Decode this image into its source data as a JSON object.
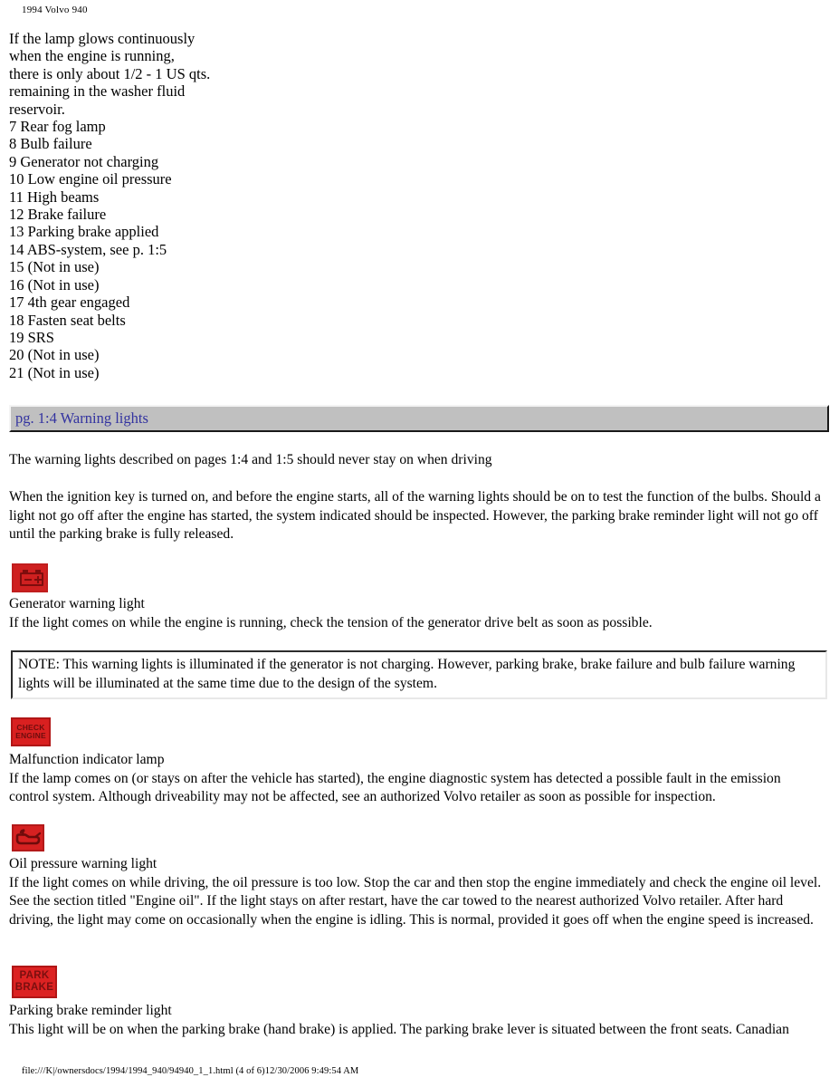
{
  "running_head": "1994 Volvo 940",
  "intro_lines": [
    "If the lamp glows continuously",
    "when the engine is running,",
    "there is only about 1/2 - 1 US qts.",
    "remaining in the washer fluid",
    "reservoir."
  ],
  "symbol_list": [
    "7 Rear fog lamp",
    "8 Bulb failure",
    "9 Generator not charging",
    "10 Low engine oil pressure",
    "11 High beams",
    "12 Brake failure",
    "13 Parking brake applied",
    "14 ABS-system, see p. 1:5",
    "15 (Not in use)",
    "16 (Not in use)",
    "17 4th gear engaged",
    "18 Fasten seat belts",
    "19 SRS",
    "20 (Not in use)",
    "21 (Not in use)"
  ],
  "heading": {
    "label": "pg. 1:4 Warning lights",
    "text_color": "#3333a0",
    "bar_color": "#c0c0c0"
  },
  "paragraphs": {
    "intro": "The warning lights described on pages 1:4 and 1:5 should never stay on when driving",
    "bulb_test": "When the ignition key is turned on, and before the engine starts, all of the warning lights should be on to test the function of the bulbs. Should a light not go off after the engine has started, the system indicated should be inspected. However, the parking brake reminder light will not go off until the parking brake is fully released."
  },
  "warning_lights": [
    {
      "icon": "battery-icon",
      "icon_color": "#cf2020",
      "title": "Generator warning light",
      "body": "If the light comes on while the engine is running, check the tension of the generator drive belt as soon as possible."
    },
    {
      "icon": "check-engine-icon",
      "icon_color": "#d92020",
      "icon_line1": "CHECK",
      "icon_line2": "ENGINE",
      "title": "Malfunction indicator lamp",
      "body": "If the lamp comes on (or stays on after the vehicle has started), the engine diagnostic system has detected a possible fault in the emission control system. Although driveability may not be affected, see an authorized Volvo retailer as soon as possible for inspection."
    },
    {
      "icon": "oil-can-icon",
      "icon_color": "#d52121",
      "title": "Oil pressure warning light",
      "body": "If the light comes on while driving, the oil pressure is too low. Stop the car and then stop the engine immediately and check the engine oil level. See the section titled \"Engine oil\". If the light stays on after restart, have the car towed to the nearest authorized Volvo retailer. After hard driving, the light may come on occasionally when the engine is idling. This is normal, provided it goes off when the engine speed is increased."
    },
    {
      "icon": "park-brake-icon",
      "icon_color": "#dc2222",
      "icon_line1": "PARK",
      "icon_line2": "BRAKE",
      "title": "Parking brake reminder light",
      "body": "This light will be on when the parking brake (hand brake) is applied. The parking brake lever is situated between the front seats. Canadian"
    }
  ],
  "note": {
    "text": "NOTE: This warning lights is illuminated if the generator is not charging. However, parking brake, brake failure and bulb failure warning lights will be illuminated at the same time due to the design of the system."
  },
  "footer": "file:///K|/ownersdocs/1994/1994_940/94940_1_1.html (4 of 6)12/30/2006 9:49:54 AM"
}
